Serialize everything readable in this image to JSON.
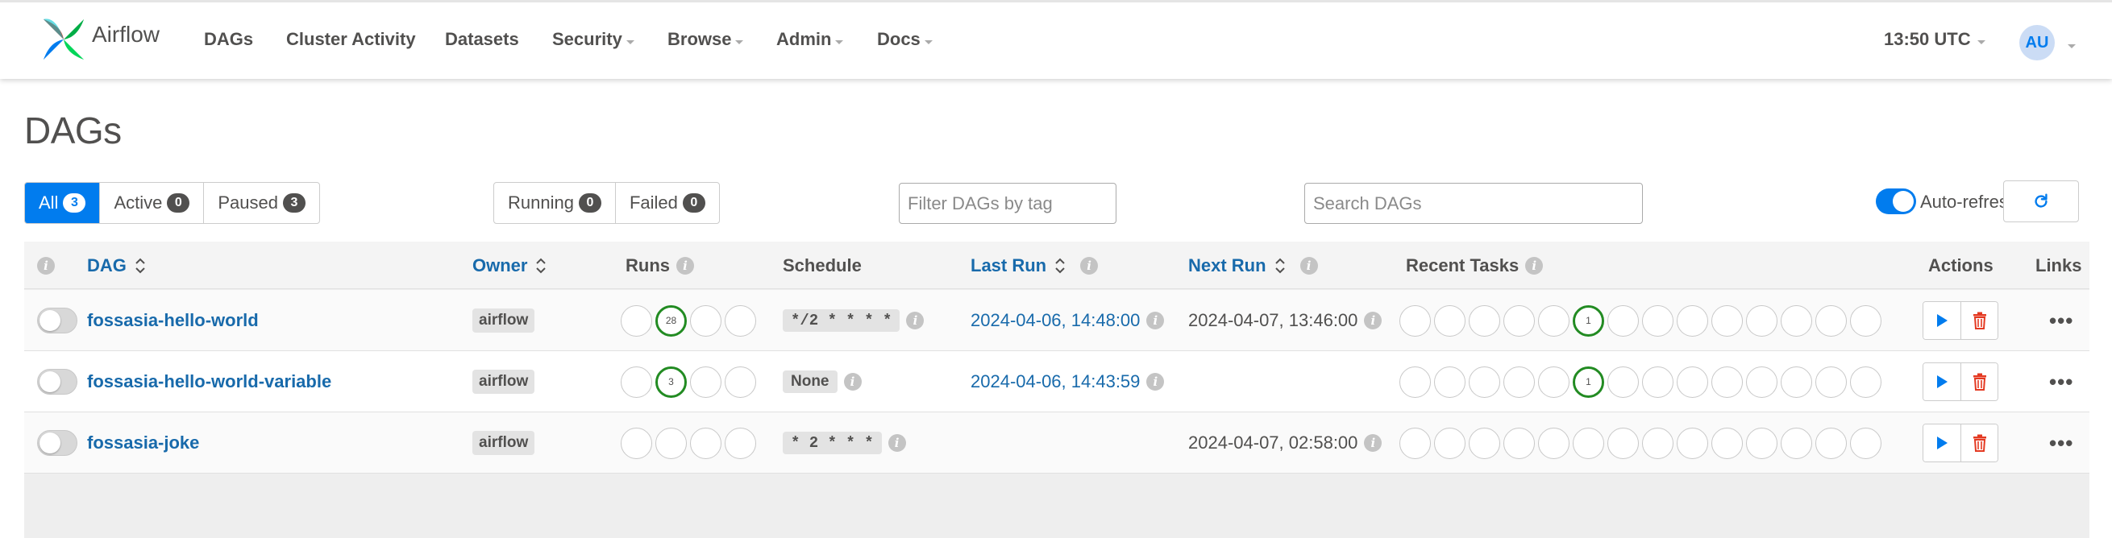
{
  "nav": {
    "brand": "Airflow",
    "items": [
      {
        "label": "DAGs"
      },
      {
        "label": "Cluster Activity"
      },
      {
        "label": "Datasets"
      },
      {
        "label": "Security"
      },
      {
        "label": "Browse"
      },
      {
        "label": "Admin"
      },
      {
        "label": "Docs"
      }
    ],
    "clock": "13:50 UTC",
    "avatar": "AU"
  },
  "page": {
    "title": "DAGs"
  },
  "status_filters": [
    {
      "label": "All",
      "count": "3"
    },
    {
      "label": "Active",
      "count": "0"
    },
    {
      "label": "Paused",
      "count": "3"
    }
  ],
  "run_filters": [
    {
      "label": "Running",
      "count": "0"
    },
    {
      "label": "Failed",
      "count": "0"
    }
  ],
  "tag_filter": {
    "placeholder": "Filter DAGs by tag"
  },
  "search": {
    "placeholder": "Search DAGs"
  },
  "auto_refresh": {
    "label": "Auto-refresh",
    "on": true
  },
  "table": {
    "headers": {
      "dag": "DAG",
      "owner": "Owner",
      "runs": "Runs",
      "schedule": "Schedule",
      "last_run": "Last Run",
      "next_run": "Next Run",
      "recent_tasks": "Recent Tasks",
      "actions": "Actions",
      "links": "Links"
    },
    "rows": [
      {
        "dag": "fossasia-hello-world",
        "owner": "airflow",
        "runs": [
          "",
          "28",
          "",
          ""
        ],
        "schedule": "*/2 * * * *",
        "last_run": "2024-04-06, 14:48:00",
        "next_run": "2024-04-07, 13:46:00",
        "recent_tasks_success": "1"
      },
      {
        "dag": "fossasia-hello-world-variable",
        "owner": "airflow",
        "runs": [
          "",
          "3",
          "",
          ""
        ],
        "schedule": "None",
        "last_run": "2024-04-06, 14:43:59",
        "next_run": "",
        "recent_tasks_success": "1"
      },
      {
        "dag": "fossasia-joke",
        "owner": "airflow",
        "runs": [
          "",
          "",
          "",
          ""
        ],
        "schedule": "* 2 * * *",
        "last_run": "",
        "next_run": "2024-04-07, 02:58:00",
        "recent_tasks_success": ""
      }
    ]
  },
  "colors": {
    "primary": "#017cee",
    "link": "#186aab",
    "success": "#228b22",
    "delete": "#e43921",
    "text": "#51504f"
  }
}
